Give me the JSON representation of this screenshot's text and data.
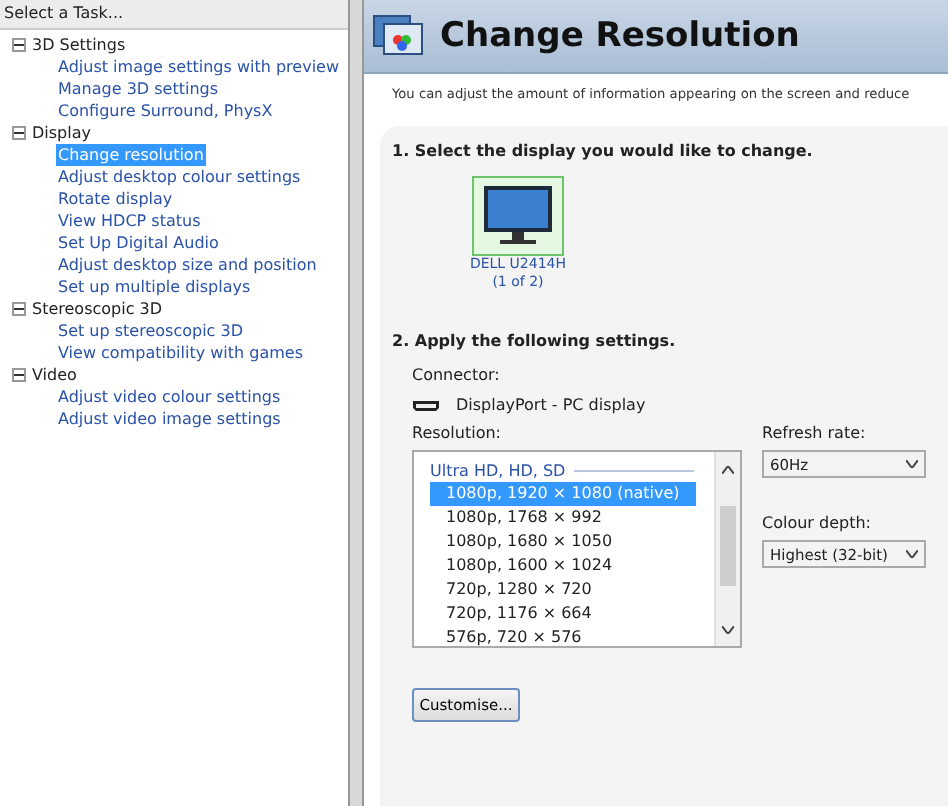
{
  "sidebar": {
    "title": "Select a Task...",
    "tree": [
      {
        "label": "3D Settings",
        "expanded": true,
        "children": [
          {
            "label": "Adjust image settings with preview",
            "selected": false
          },
          {
            "label": "Manage 3D settings",
            "selected": false
          },
          {
            "label": "Configure Surround, PhysX",
            "selected": false
          }
        ]
      },
      {
        "label": "Display",
        "expanded": true,
        "children": [
          {
            "label": "Change resolution",
            "selected": true
          },
          {
            "label": "Adjust desktop colour settings",
            "selected": false
          },
          {
            "label": "Rotate display",
            "selected": false
          },
          {
            "label": "View HDCP status",
            "selected": false
          },
          {
            "label": "Set Up Digital Audio",
            "selected": false
          },
          {
            "label": "Adjust desktop size and position",
            "selected": false
          },
          {
            "label": "Set up multiple displays",
            "selected": false
          }
        ]
      },
      {
        "label": "Stereoscopic 3D",
        "expanded": true,
        "children": [
          {
            "label": "Set up stereoscopic 3D",
            "selected": false
          },
          {
            "label": "View compatibility with games",
            "selected": false
          }
        ]
      },
      {
        "label": "Video",
        "expanded": true,
        "children": [
          {
            "label": "Adjust video colour settings",
            "selected": false
          },
          {
            "label": "Adjust video image settings",
            "selected": false
          }
        ]
      }
    ]
  },
  "page": {
    "title": "Change Resolution",
    "description": "You can adjust the amount of information appearing on the screen and reduce",
    "step1": {
      "heading": "1. Select the display you would like to change.",
      "displays": [
        {
          "name": "DELL U2414H",
          "index": "(1 of 2)",
          "selected": true
        }
      ]
    },
    "step2": {
      "heading": "2. Apply the following settings.",
      "connector_label": "Connector:",
      "connector": "DisplayPort - PC display",
      "resolution_label": "Resolution:",
      "resolutions": {
        "group": "Ultra HD, HD, SD",
        "items": [
          {
            "label": "1080p, 1920 × 1080 (native)",
            "selected": true
          },
          {
            "label": "1080p, 1768 × 992",
            "selected": false
          },
          {
            "label": "1080p, 1680 × 1050",
            "selected": false
          },
          {
            "label": "1080p, 1600 × 1024",
            "selected": false
          },
          {
            "label": "720p, 1280 × 720",
            "selected": false
          },
          {
            "label": "720p, 1176 × 664",
            "selected": false
          },
          {
            "label": "576p, 720 × 576",
            "selected": false
          }
        ]
      },
      "refresh_label": "Refresh rate:",
      "refresh": "60Hz",
      "depth_label": "Colour depth:",
      "depth": "Highest (32-bit)",
      "customise_button": "Customise..."
    }
  }
}
